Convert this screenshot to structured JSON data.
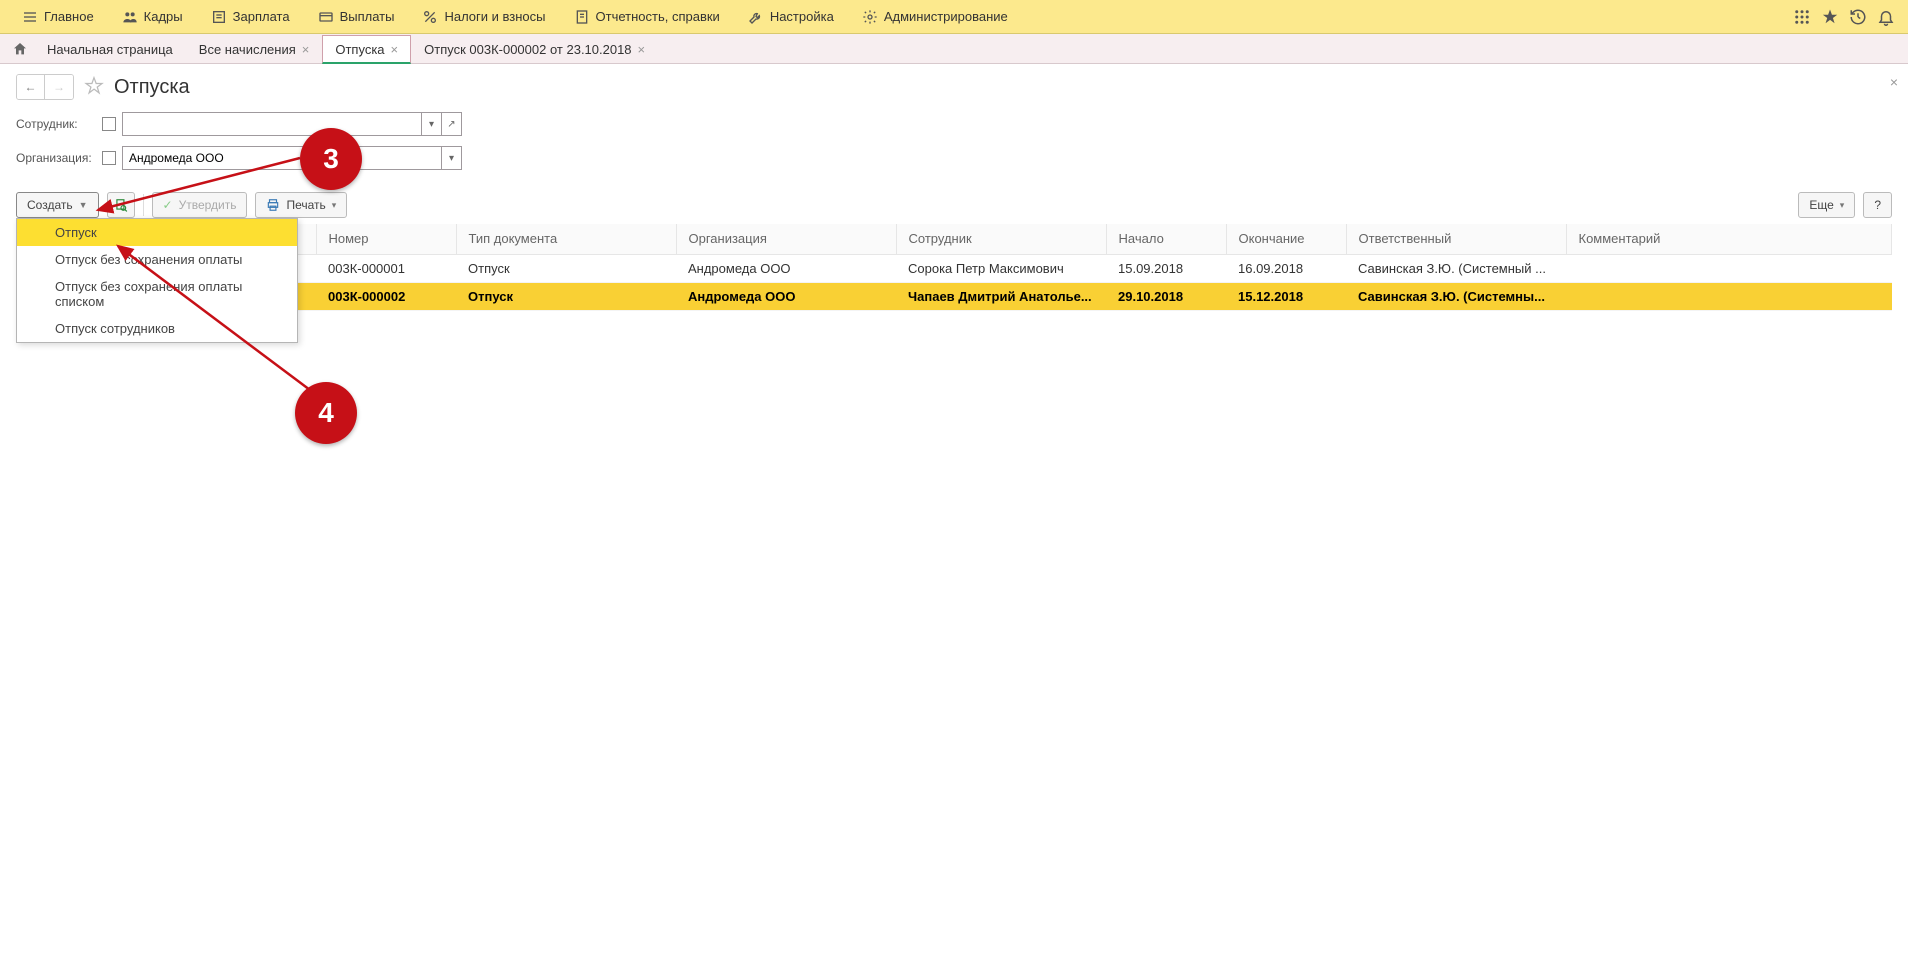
{
  "topbar": {
    "items": [
      {
        "label": "Главное",
        "icon": "menu-icon"
      },
      {
        "label": "Кадры",
        "icon": "people-icon"
      },
      {
        "label": "Зарплата",
        "icon": "list-icon"
      },
      {
        "label": "Выплаты",
        "icon": "card-icon"
      },
      {
        "label": "Налоги и взносы",
        "icon": "percent-icon"
      },
      {
        "label": "Отчетность, справки",
        "icon": "report-icon"
      },
      {
        "label": "Настройка",
        "icon": "wrench-icon"
      },
      {
        "label": "Администрирование",
        "icon": "gear-icon"
      }
    ]
  },
  "tabs": [
    {
      "label": "Начальная страница",
      "closable": false
    },
    {
      "label": "Все начисления",
      "closable": true
    },
    {
      "label": "Отпуска",
      "closable": true,
      "active": true
    },
    {
      "label": "Отпуск 003К-000002 от 23.10.2018",
      "closable": true
    }
  ],
  "page": {
    "title": "Отпуска"
  },
  "filters": {
    "employee_label": "Сотрудник:",
    "employee_value": "",
    "org_label": "Организация:",
    "org_value": "Андромеда ООО"
  },
  "toolbar": {
    "create_label": "Создать",
    "approve_label": "Утвердить",
    "print_label": "Печать",
    "more_label": "Еще",
    "help_label": "?"
  },
  "dropdown": {
    "items": [
      "Отпуск",
      "Отпуск без сохранения оплаты",
      "Отпуск без сохранения оплаты списком",
      "Отпуск сотрудников"
    ]
  },
  "table": {
    "columns": [
      "Номер",
      "Тип документа",
      "Организация",
      "Сотрудник",
      "Начало",
      "Окончание",
      "Ответственный",
      "Комментарий"
    ],
    "rows": [
      {
        "num": "003К-000001",
        "type": "Отпуск",
        "org": "Андромеда ООО",
        "emp": "Сорока Петр Максимович",
        "start": "15.09.2018",
        "end": "16.09.2018",
        "resp": "Савинская З.Ю. (Системный ...",
        "comment": "",
        "selected": false
      },
      {
        "num": "003К-000002",
        "type": "Отпуск",
        "org": "Андромеда ООО",
        "emp": "Чапаев Дмитрий Анатолье...",
        "start": "29.10.2018",
        "end": "15.12.2018",
        "resp": "Савинская З.Ю. (Системны...",
        "comment": "",
        "selected": true
      }
    ]
  },
  "annotations": {
    "badge3": "3",
    "badge4": "4"
  }
}
